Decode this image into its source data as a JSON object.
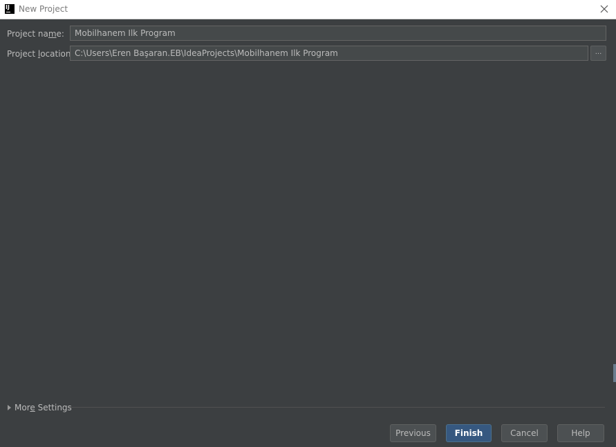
{
  "window": {
    "title": "New Project",
    "app_icon_text": "IJ"
  },
  "form": {
    "project_name": {
      "label_pre": "Project na",
      "label_mnemonic": "m",
      "label_post": "e:",
      "value": "Mobilhanem Ilk Program"
    },
    "project_location": {
      "label_pre": "Project ",
      "label_mnemonic": "l",
      "label_post": "ocation:",
      "value": "C:\\Users\\Eren Başaran.EB\\IdeaProjects\\Mobilhanem Ilk Program",
      "browse_label": "..."
    }
  },
  "more_settings": {
    "label_pre": "Mor",
    "label_mnemonic": "e",
    "label_post": " Settings"
  },
  "buttons": {
    "previous": "Previous",
    "finish": "Finish",
    "cancel": "Cancel",
    "help": "Help"
  },
  "colors": {
    "background": "#3c3f41",
    "field_background": "#45494a",
    "text": "#bbbbbb",
    "primary_button": "#365880"
  },
  "icons": {
    "app": "intellij-idea-icon",
    "close": "close-icon",
    "expand": "triangle-right-icon"
  }
}
